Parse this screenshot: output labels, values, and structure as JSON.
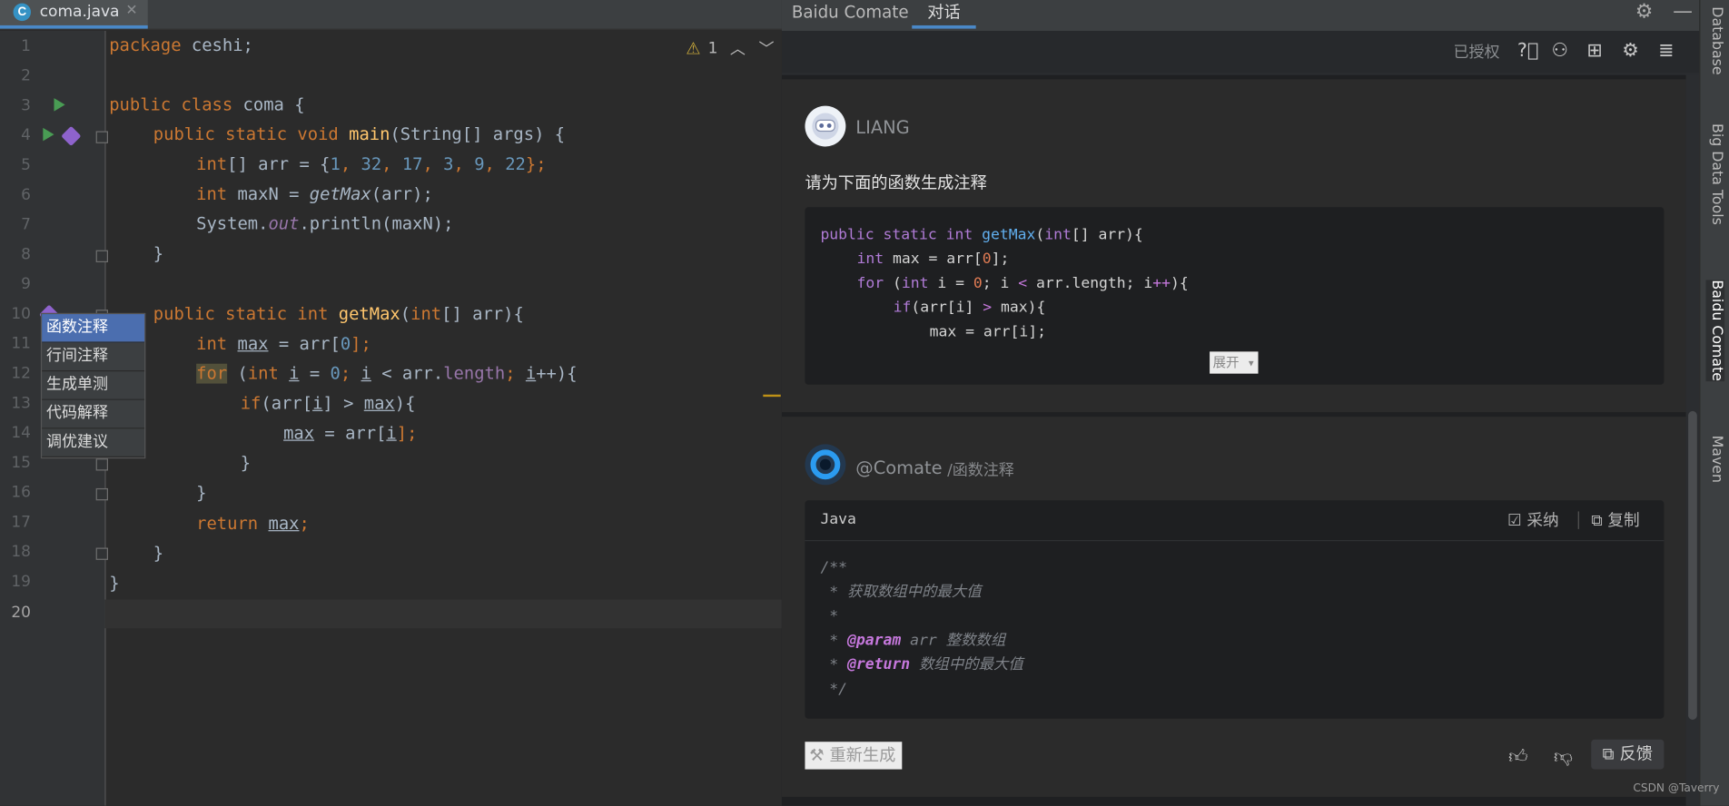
{
  "editor": {
    "tab": {
      "file_icon": "C",
      "filename": "coma.java",
      "close": "✕"
    },
    "inspection": {
      "warning_count": "1"
    },
    "line_numbers": [
      "1",
      "2",
      "3",
      "4",
      "5",
      "6",
      "7",
      "8",
      "9",
      "10",
      "11",
      "12",
      "13",
      "14",
      "15",
      "16",
      "17",
      "18",
      "19",
      "20"
    ],
    "code": {
      "l1_kw": "package",
      "l1_rest": " ceshi;",
      "l3_kw": "public class",
      "l3_rest": " coma {",
      "l4_kw": "public static void",
      "l4_fn": "main",
      "l4_rest": "(String[] args) {",
      "l5_kw": "int",
      "l5_a": "[] arr = {",
      "l5_n1": "1",
      "l5_n2": "32",
      "l5_n3": "17",
      "l5_n4": "3",
      "l5_n5": "9",
      "l5_n6": "22",
      "l5_end": "};",
      "l6_kw": "int",
      "l6_a": " maxN = ",
      "l6_fn": "getMax",
      "l6_b": "(arr);",
      "l7_a": "System.",
      "l7_it": "out",
      "l7_b": ".println(maxN);",
      "l8": "}",
      "l10_kw": "public static int",
      "l10_fn": "getMax",
      "l10_a": "(",
      "l10_kw2": "int",
      "l10_b": "[] arr){",
      "l11_kw": "int",
      "l11_v": "max",
      "l11_a": " = arr[",
      "l11_n": "0",
      "l11_b": "];",
      "l12_kw": "for",
      "l12_a": " (",
      "l12_kw2": "int",
      "l12_v": "i",
      "l12_b": " = ",
      "l12_n": "0",
      "l12_c": "; ",
      "l12_v2": "i",
      "l12_d": " < arr.",
      "l12_p": "length",
      "l12_e": "; ",
      "l12_v3": "i",
      "l12_f": "++){",
      "l13_kw": "if",
      "l13_a": "(arr[",
      "l13_v": "i",
      "l13_b": "] > ",
      "l13_v2": "max",
      "l13_c": "){",
      "l14_v": "max",
      "l14_a": " = arr[",
      "l14_v2": "i",
      "l14_b": "];",
      "l15": "}",
      "l16": "}",
      "l17_kw": "return",
      "l17_v": "max",
      "l17_b": ";",
      "l18": "}",
      "l19": "}"
    },
    "popup_menu": [
      "函数注释",
      "行间注释",
      "生成单测",
      "代码解释",
      "调优建议"
    ]
  },
  "panel": {
    "title": "Baidu Comate",
    "tab": "对话",
    "toolbar": {
      "authorized": "已授权"
    },
    "user_message": {
      "name": "LIANG",
      "question": "请为下面的函数生成注释",
      "code": {
        "r1_kw": "public static int",
        "r1_fn": "getMax",
        "r1_a": "(",
        "r1_kw2": "int",
        "r1_b": "[] arr){",
        "r2_kw": "int",
        "r2_a": " max = arr[",
        "r2_n": "0",
        "r2_b": "];",
        "r3_kw": "for",
        "r3_a": " (",
        "r3_kw2": "int",
        "r3_b": " i = ",
        "r3_n": "0",
        "r3_c": "; i ",
        "r3_op": "<",
        "r3_d": " arr.length; i",
        "r3_op2": "++",
        "r3_e": "){",
        "r4_kw": "if",
        "r4_a": "(arr[i] ",
        "r4_op": ">",
        "r4_b": " max){",
        "r5": "max = arr[i];"
      },
      "expand": "展开 ▾"
    },
    "reply": {
      "name": "@Comate",
      "command": "/函数注释",
      "language": "Java",
      "adopt": "采纳",
      "copy": "复制",
      "comment": {
        "c1": "/**",
        "c2": " * 获取数组中的最大值",
        "c3": " *",
        "c4_a": " * ",
        "c4_tag": "@param",
        "c4_b": " arr 整数数组",
        "c5_a": " * ",
        "c5_tag": "@return",
        "c5_b": " 数组中的最大值",
        "c6": " */"
      },
      "regenerate": "重新生成",
      "feedback": "反馈"
    }
  },
  "right_sidebar": [
    "Database",
    "Big Data Tools",
    "Baidu Comate",
    "Maven"
  ],
  "watermark": "CSDN @Taverry"
}
